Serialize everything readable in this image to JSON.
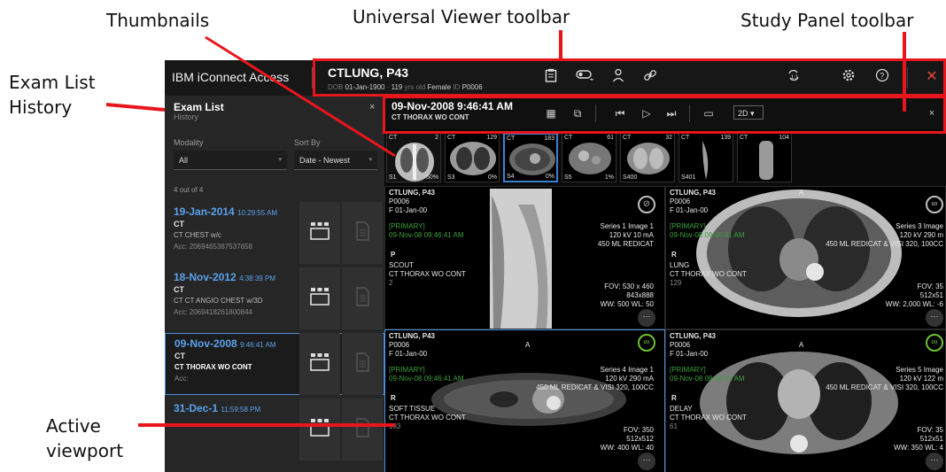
{
  "callouts": {
    "thumbnails": "Thumbnails",
    "uv_toolbar": "Universal Viewer toolbar",
    "study_panel_toolbar": "Study Panel toolbar",
    "exam_list_line1": "Exam List",
    "exam_list_line2": "History",
    "active_line1": "Active",
    "active_line2": "viewport"
  },
  "app": {
    "brand": "IBM iConnect Access",
    "patient": {
      "name": "CTLUNG, P43",
      "dob_label": "DOB",
      "dob": "01-Jan-1900",
      "age": "119",
      "age_suffix": "yrs old",
      "sex": "Female",
      "id_label": "ID",
      "id": "P0006"
    },
    "toolbar_icons": [
      "clipboard-icon",
      "toggle-icon",
      "person-icon",
      "link-icon",
      "sync-icon",
      "settings-icon",
      "help-icon",
      "close-icon"
    ]
  },
  "exam_list": {
    "title": "Exam List",
    "subtitle": "History",
    "close": "×",
    "modality_label": "Modality",
    "modality_value": "All",
    "sort_label": "Sort By",
    "sort_value": "Date - Newest",
    "count": "4 out of 4",
    "items": [
      {
        "date": "19-Jan-2014",
        "time": "10:29:55 AM",
        "modality": "CT",
        "description": "CT CHEST w/c",
        "acc": "Acc: 2069465387537658"
      },
      {
        "date": "18-Nov-2012",
        "time": "4:38:39 PM",
        "modality": "CT",
        "description": "CT CT ANGIO CHEST w/3D",
        "acc": "Acc: 2069418261800844"
      },
      {
        "date": "09-Nov-2008",
        "time": "9:46:41 AM",
        "modality": "CT",
        "description": "CT THORAX WO CONT",
        "acc": "Acc:"
      },
      {
        "date": "31-Dec-1",
        "time": "11:59:58 PM",
        "modality": "",
        "description": "",
        "acc": ""
      }
    ]
  },
  "study": {
    "date": "09-Nov-2008 9:46:41 AM",
    "description": "CT THORAX WO CONT",
    "layout_value": "2D ▾",
    "close": "×"
  },
  "thumbnails": [
    {
      "mod": "CT",
      "num": "2",
      "series": "S1",
      "pct": "50%"
    },
    {
      "mod": "CT",
      "num": "129",
      "series": "S3",
      "pct": "0%"
    },
    {
      "mod": "CT",
      "num": "183",
      "series": "S4",
      "pct": "0%"
    },
    {
      "mod": "CT",
      "num": "61",
      "series": "S5",
      "pct": "1%"
    },
    {
      "mod": "CT",
      "num": "32",
      "series": "S400",
      "pct": ""
    },
    {
      "mod": "CT",
      "num": "139",
      "series": "S401",
      "pct": ""
    },
    {
      "mod": "CT",
      "num": "104",
      "series": "",
      "pct": ""
    }
  ],
  "viewports": [
    {
      "patient": "CTLUNG, P43",
      "id": "P0006",
      "sexdob": "F 01-Jan-00",
      "primary": "[PRIMARY]",
      "datetime": "09-Nov-08 09:46:41 AM",
      "orient": "P",
      "series_name": "SCOUT",
      "desc": "CT THORAX WO CONT",
      "img": "2",
      "series_info": "Series 1 Image 1",
      "kv": "120 kV 10 mA",
      "contrast": "450 ML REDICAT",
      "fov": "FOV: 530 x 460",
      "matrix": "843x888",
      "wl": "WW: 500 WL: 50",
      "top": ""
    },
    {
      "patient": "CTLUNG, P43",
      "id": "P0006",
      "sexdob": "F 01-Jan-00",
      "primary": "[PRIMARY]",
      "datetime": "09-Nov-08 09:46:41 AM",
      "orient": "R",
      "series_name": "LUNG",
      "desc": "CT THORAX WO CONT",
      "img": "129",
      "series_info": "Series 3 Image",
      "kv": "120 kV 290 m",
      "contrast": "450 ML REDICAT & VISI 320, 100CC",
      "fov": "FOV: 35",
      "matrix": "512x51",
      "wl": "WW: 2,000 WL: -6",
      "top": "A"
    },
    {
      "patient": "CTLUNG, P43",
      "id": "P0006",
      "sexdob": "F 01-Jan-00",
      "primary": "[PRIMARY]",
      "datetime": "09-Nov-08 09:46:41 AM",
      "orient": "R",
      "series_name": "SOFT TISSUE",
      "desc": "CT THORAX WO CONT",
      "img": "183",
      "series_info": "Series 4 Image 1",
      "kv": "120 kV 290 mA",
      "contrast": "450 ML REDICAT & VISI 320, 100CC",
      "fov": "FOV: 350",
      "matrix": "512x512",
      "wl": "WW: 400 WL: 40",
      "top": "A"
    },
    {
      "patient": "CTLUNG, P43",
      "id": "P0006",
      "sexdob": "F 01-Jan-00",
      "primary": "[PRIMARY]",
      "datetime": "09-Nov-08 09:46:41 AM",
      "orient": "R",
      "series_name": "DELAY",
      "desc": "CT THORAX WO CONT",
      "img": "61",
      "series_info": "Series 5 Image",
      "kv": "120 kV 122 m",
      "contrast": "450 ML REDICAT & VISI 320, 100CC",
      "fov": "FOV: 35",
      "matrix": "512x51",
      "wl": "WW: 350 WL: 4",
      "top": "A"
    }
  ],
  "colors": {
    "annotation_red": "#e8161c",
    "active_blue": "#4a8fd8",
    "date_blue": "#5aa2ec",
    "overlay_green": "#3ba03b"
  }
}
